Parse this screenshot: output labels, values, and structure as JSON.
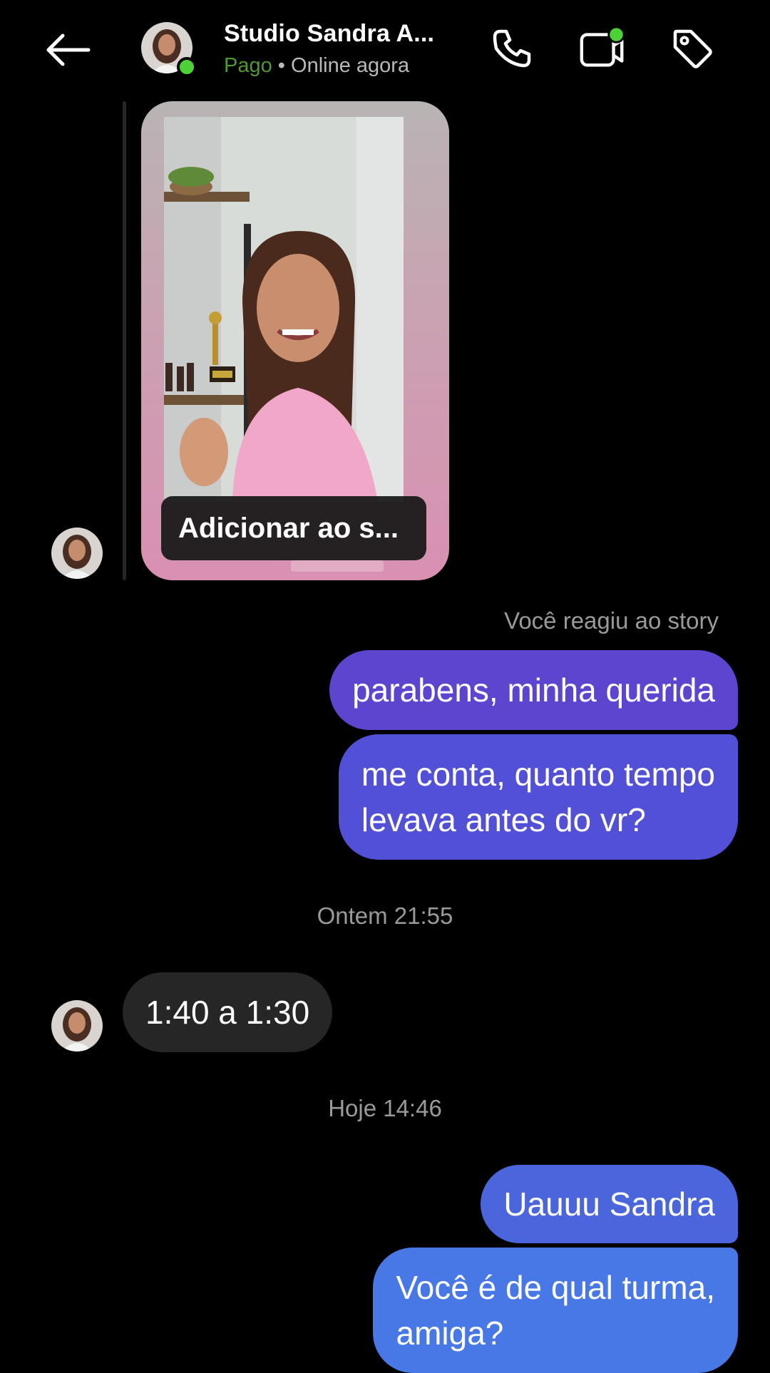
{
  "header": {
    "title": "Studio Sandra A...",
    "status_paid": "Pago",
    "status_separator": " • ",
    "status_online": "Online agora",
    "icons": {
      "back": "arrow-left-icon",
      "call": "phone-icon",
      "video": "video-camera-icon",
      "tag": "tag-icon"
    },
    "online_color": "#4cd137",
    "paid_color": "#4e9a2f"
  },
  "story": {
    "caption": "Adicionar ao s..."
  },
  "conversation": {
    "reaction_note": "Você reagiu ao story",
    "outgoing_1": "parabens, minha querida",
    "outgoing_2_line1": "me conta, quanto tempo",
    "outgoing_2_line2": "levava antes do vr?",
    "timestamp_1": "Ontem 21:55",
    "incoming_1": "1:40 a 1:30",
    "timestamp_2": "Hoje 14:46",
    "outgoing_3": "Uauuu Sandra",
    "outgoing_4_line1": "Você é de qual turma,",
    "outgoing_4_line2": "amiga?"
  },
  "colors": {
    "background": "#000000",
    "incoming_bubble": "#262626",
    "outgoing_gradient_top": "#5d45d0",
    "outgoing_gradient_bottom": "#4877e6"
  }
}
